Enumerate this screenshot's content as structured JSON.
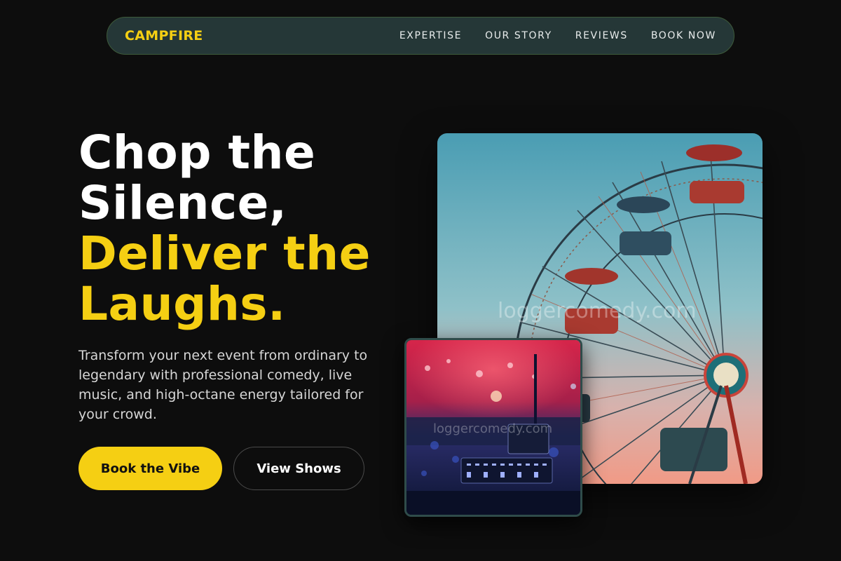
{
  "nav": {
    "brand": "CAMPFIRE",
    "links": [
      "EXPERTISE",
      "OUR STORY",
      "REVIEWS",
      "BOOK NOW"
    ]
  },
  "hero": {
    "headline_line1": "Chop the",
    "headline_line2": "Silence,",
    "headline_line3": "Deliver the",
    "headline_line4": "Laughs.",
    "subtext": "Transform your next event from ordinary to legendary with professional comedy, live music, and high-octane energy tailored for your crowd.",
    "primary_button": "Book the Vibe",
    "secondary_button": "View Shows"
  },
  "images": {
    "main_watermark": "loggercomedy.com",
    "small_watermark": "loggercomedy.com"
  },
  "colors": {
    "background": "#0d0d0d",
    "accent": "#f5cf13",
    "nav_bg": "#253737"
  }
}
